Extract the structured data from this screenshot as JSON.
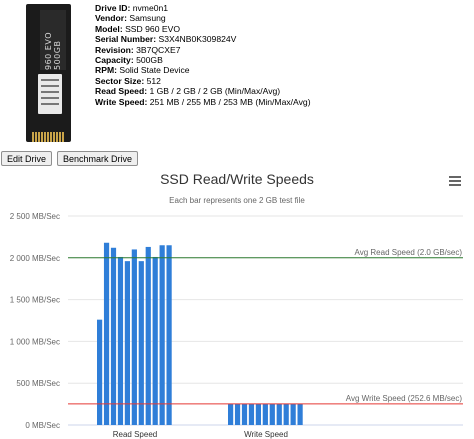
{
  "drive": {
    "labels": {
      "id": "Drive ID:",
      "vendor": "Vendor:",
      "model": "Model:",
      "serial": "Serial Number:",
      "revision": "Revision:",
      "capacity": "Capacity:",
      "rpm": "RPM:",
      "sector": "Sector Size:",
      "read": "Read Speed:",
      "write": "Write Speed:"
    },
    "values": {
      "id": "nvme0n1",
      "vendor": "Samsung",
      "model": "SSD 960 EVO",
      "serial": "S3X4NB0K309824V",
      "revision": "3B7QCXE7",
      "capacity": "500GB",
      "rpm": "Solid State Device",
      "sector": "512",
      "read": "1 GB / 2 GB / 2 GB (Min/Max/Avg)",
      "write": "251 MB / 255 MB / 253 MB (Min/Max/Avg)"
    },
    "image_text": "960 EVO 500GB"
  },
  "buttons": {
    "edit": "Edit Drive",
    "benchmark": "Benchmark Drive"
  },
  "menu_icon": "hamburger-menu-icon",
  "chart_data": {
    "type": "bar",
    "title": "SSD Read/Write Speeds",
    "subtitle": "Each bar represents one 2 GB test file",
    "categories": [
      "Read Speed",
      "Write Speed"
    ],
    "ylabel": "",
    "ylim": [
      0,
      2500
    ],
    "yticks": [
      0,
      500,
      1000,
      1500,
      2000,
      2500
    ],
    "ytick_labels": [
      "0 MB/Sec",
      "500 MB/Sec",
      "1 000 MB/Sec",
      "1 500 MB/Sec",
      "2 000 MB/Sec",
      "2 500 MB/Sec"
    ],
    "grid": true,
    "bar_color": "#2f7ed8",
    "read_values": [
      1260,
      2180,
      2120,
      2010,
      1960,
      2100,
      1960,
      2130,
      2010,
      2150,
      2150
    ],
    "write_values": [
      251,
      253,
      252,
      253,
      253,
      251,
      253,
      252,
      254,
      255,
      253
    ],
    "plot_lines": [
      {
        "label": "Avg Read Speed (2.0 GB/sec)",
        "value": 2000,
        "color": "#2e7d32"
      },
      {
        "label": "Avg Write Speed (252.6 MB/sec)",
        "value": 252.6,
        "color": "#e53935"
      }
    ]
  }
}
